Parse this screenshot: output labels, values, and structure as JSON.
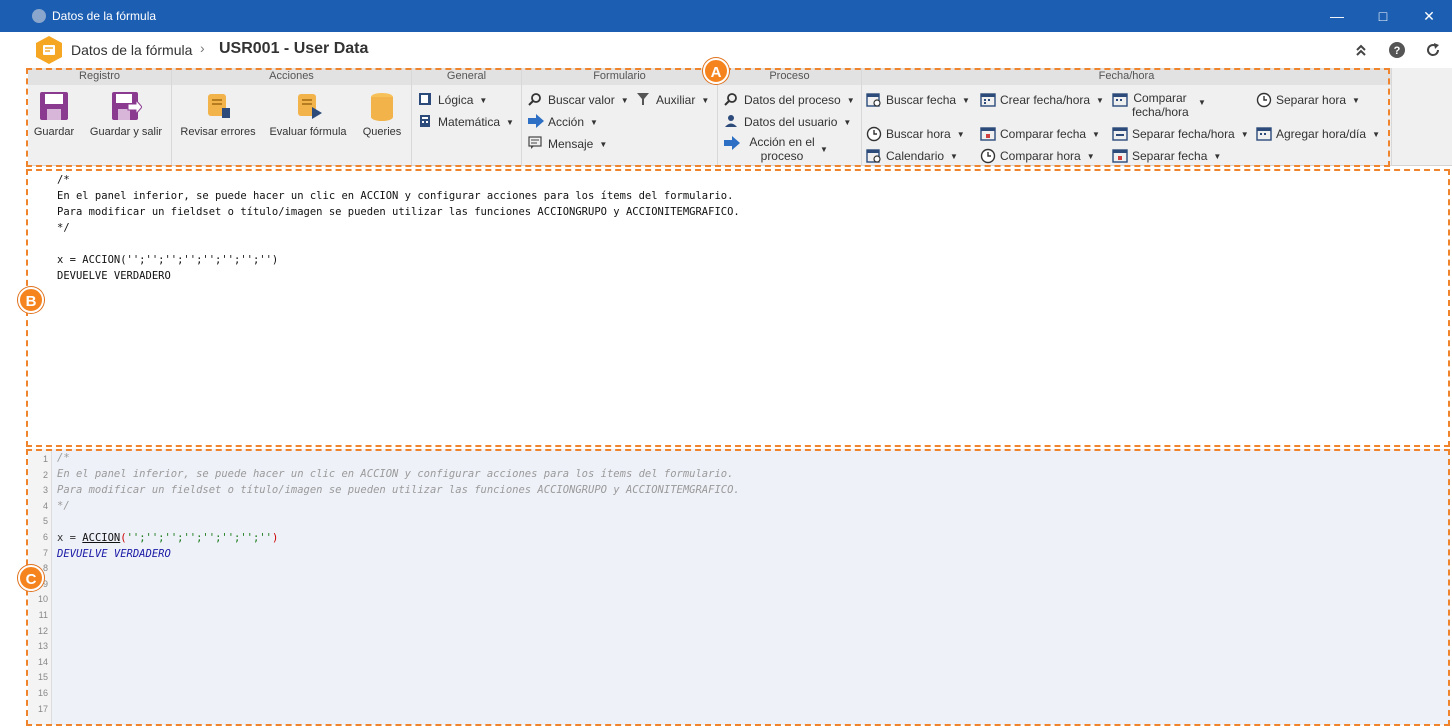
{
  "window": {
    "title": "Datos de la fórmula"
  },
  "header": {
    "breadcrumb_root": "Datos de la fórmula",
    "separator": "›",
    "record_title": "USR001 - User Data"
  },
  "ribbon": {
    "registro": {
      "title": "Registro",
      "save": "Guardar",
      "save_exit": "Guardar y salir"
    },
    "acciones": {
      "title": "Acciones",
      "review": "Revisar errores",
      "evaluate": "Evaluar fórmula",
      "queries": "Queries"
    },
    "general": {
      "title": "General",
      "logica": "Lógica",
      "matematica": "Matemática"
    },
    "formulario": {
      "title": "Formulario",
      "buscar_valor": "Buscar valor",
      "auxiliar": "Auxiliar",
      "accion": "Acción",
      "mensaje": "Mensaje"
    },
    "proceso": {
      "title": "Proceso",
      "datos_proceso": "Datos del proceso",
      "datos_usuario": "Datos del usuario",
      "accion_proceso_1": "Acción en el",
      "accion_proceso_2": "proceso"
    },
    "fecha": {
      "title": "Fecha/hora",
      "buscar_fecha": "Buscar fecha",
      "crear_fecha_hora": "Crear fecha/hora",
      "comparar_fecha_hora_1": "Comparar",
      "comparar_fecha_hora_2": "fecha/hora",
      "separar_hora": "Separar hora",
      "buscar_hora": "Buscar hora",
      "comparar_fecha": "Comparar fecha",
      "separar_fecha_hora": "Separar fecha/hora",
      "agregar_hora_dia": "Agregar hora/día",
      "calendario": "Calendario",
      "comparar_hora": "Comparar hora",
      "separar_fecha": "Separar fecha"
    }
  },
  "plain_text": {
    "l1": "/*",
    "l2": "En el panel inferior, se puede hacer un clic en ACCION y configurar acciones para los ítems del formulario.",
    "l3": "Para modificar un fieldset o título/imagen se pueden utilizar las funciones ACCIONGRUPO y ACCIONITEMGRAFICO.",
    "l4": "*/",
    "l6": "x = ACCION('';'';'';'';'';'';'';'')",
    "l7": "DEVUELVE VERDADERO"
  },
  "code_editor": {
    "line_numbers": [
      "1",
      "2",
      "3",
      "4",
      "5",
      "6",
      "7",
      "8",
      "9",
      "10",
      "11",
      "12",
      "13",
      "14",
      "15",
      "16",
      "17"
    ],
    "l1": "/*",
    "l2": "En el panel inferior, se puede hacer un clic en ACCION y configurar acciones para los ítems del formulario.",
    "l3": "Para modificar un fieldset o título/imagen se pueden utilizar las funciones ACCIONGRUPO y ACCIONITEMGRAFICO.",
    "l4": "*/",
    "l6_prefix": "x = ",
    "l6_fn": "ACCION",
    "l6_open": "(",
    "l6_args": "'';'';'';'';'';'';'';''",
    "l6_close": ")",
    "l7": "DEVUELVE VERDADERO"
  },
  "annotations": {
    "a": "A",
    "b": "B",
    "c": "C"
  },
  "colors": {
    "titlebar": "#1c5fb2",
    "annotation": "#f5841f",
    "editor_bg": "#eef1f8"
  }
}
